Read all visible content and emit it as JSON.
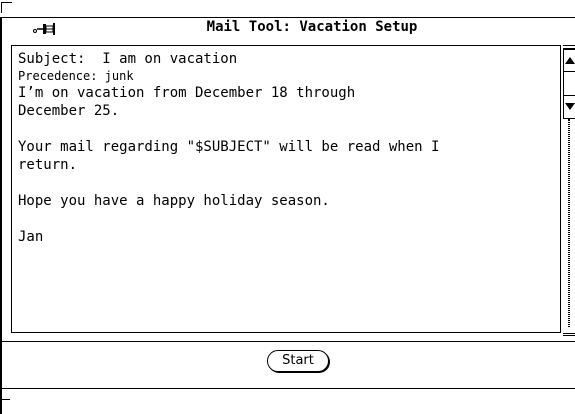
{
  "window": {
    "title": "Mail Tool: Vacation Setup"
  },
  "message": {
    "subject_line": "Subject:  I am on vacation",
    "precedence_line": "Precedence: junk",
    "body_line_1": "I’m on vacation from December 18 through",
    "body_line_2": "December 25.",
    "body_line_3": "Your mail regarding \"$SUBJECT\" will be read when I",
    "body_line_4": "return.",
    "body_line_5": "Hope you have a happy holiday season.",
    "signature": "Jan"
  },
  "controls": {
    "start_label": "Start"
  },
  "icons": {
    "pushpin": "pushpin-icon",
    "scroll_up": "scroll-up-arrow-icon",
    "scroll_down": "scroll-down-arrow-icon"
  }
}
